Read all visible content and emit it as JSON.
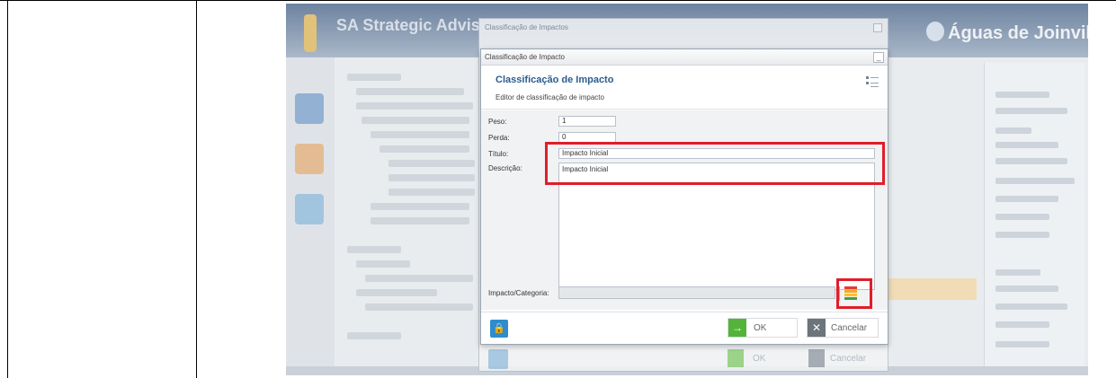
{
  "background_app": {
    "title": "SA Strategic Advis",
    "brand": "Águas de Joinville"
  },
  "back_dialog": {
    "title": "Classificação de Impactos",
    "ok_label": "OK",
    "cancel_label": "Cancelar"
  },
  "dialog": {
    "window_title": "Classificação de Impacto",
    "header_title": "Classificação de Impacto",
    "header_subtitle": "Editor de classificação de impacto",
    "fields": {
      "peso_label": "Peso:",
      "peso_value": "1",
      "perda_label": "Perda:",
      "perda_value": "0",
      "titulo_label": "Título:",
      "titulo_value": "Impacto Inicial",
      "descricao_label": "Descrição:",
      "descricao_value": "Impacto Inicial",
      "categoria_label": "Impacto/Categoria:"
    },
    "buttons": {
      "ok": "OK",
      "cancel": "Cancelar"
    }
  },
  "colors": {
    "highlight": "#e11d2a",
    "header_title": "#2b5d8f",
    "ok_green": "#55b33b"
  }
}
